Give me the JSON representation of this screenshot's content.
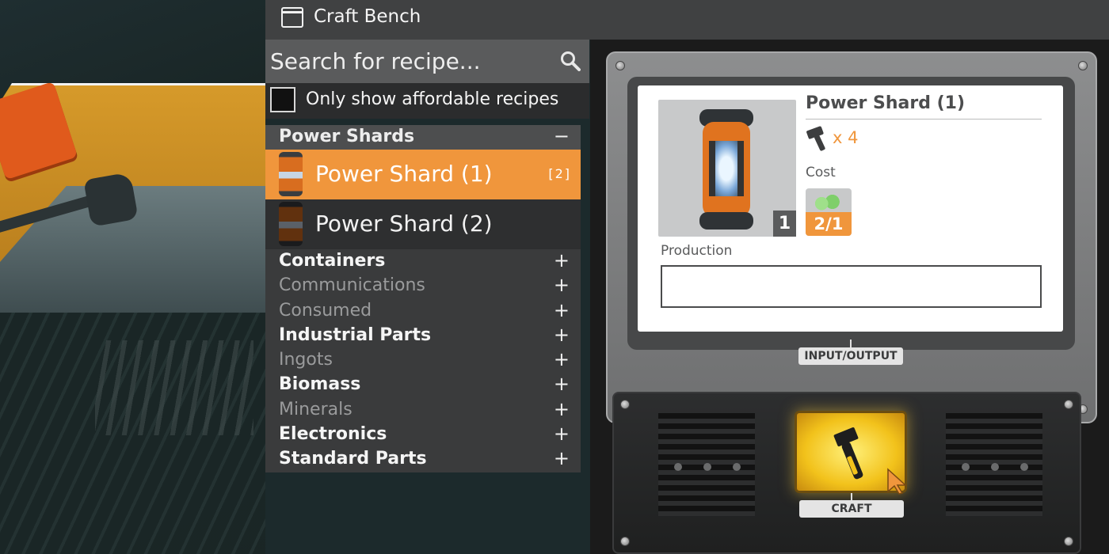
{
  "window": {
    "title": "Craft Bench"
  },
  "search": {
    "placeholder": "Search for recipe...",
    "value": ""
  },
  "filter": {
    "label": "Only show affordable recipes",
    "checked": false
  },
  "categories": [
    {
      "name": "Power Shards",
      "expanded": true,
      "toggle": "−",
      "recipes": [
        {
          "label": "Power Shard (1)",
          "count": "[2]",
          "selected": true
        },
        {
          "label": "Power Shard (2)",
          "count": "",
          "selected": false
        }
      ]
    },
    {
      "name": "Containers",
      "toggle": "+",
      "available": true
    },
    {
      "name": "Communications",
      "toggle": "+",
      "available": false
    },
    {
      "name": "Consumed",
      "toggle": "+",
      "available": false
    },
    {
      "name": "Industrial Parts",
      "toggle": "+",
      "available": true
    },
    {
      "name": "Ingots",
      "toggle": "+",
      "available": false
    },
    {
      "name": "Biomass",
      "toggle": "+",
      "available": true
    },
    {
      "name": "Minerals",
      "toggle": "+",
      "available": false
    },
    {
      "name": "Electronics",
      "toggle": "+",
      "available": true
    },
    {
      "name": "Standard Parts",
      "toggle": "+",
      "available": true
    }
  ],
  "detail": {
    "item_name": "Power Shard (1)",
    "item_qty": "1",
    "tool_multiplier": "x 4",
    "cost_label": "Cost",
    "cost_amount": "2/1",
    "production_label": "Production",
    "io_label": "INPUT/OUTPUT",
    "craft_label": "CRAFT"
  },
  "colors": {
    "accent_orange": "#f0963c",
    "craft_button": "#f2c21b",
    "panel_dark": "#2e2f30",
    "title_bar": "#404142"
  },
  "icons": {
    "window": "window-icon",
    "search": "search-icon",
    "tool": "hammer-icon",
    "craft": "hammer-icon",
    "cursor": "cursor-pointer-icon"
  }
}
